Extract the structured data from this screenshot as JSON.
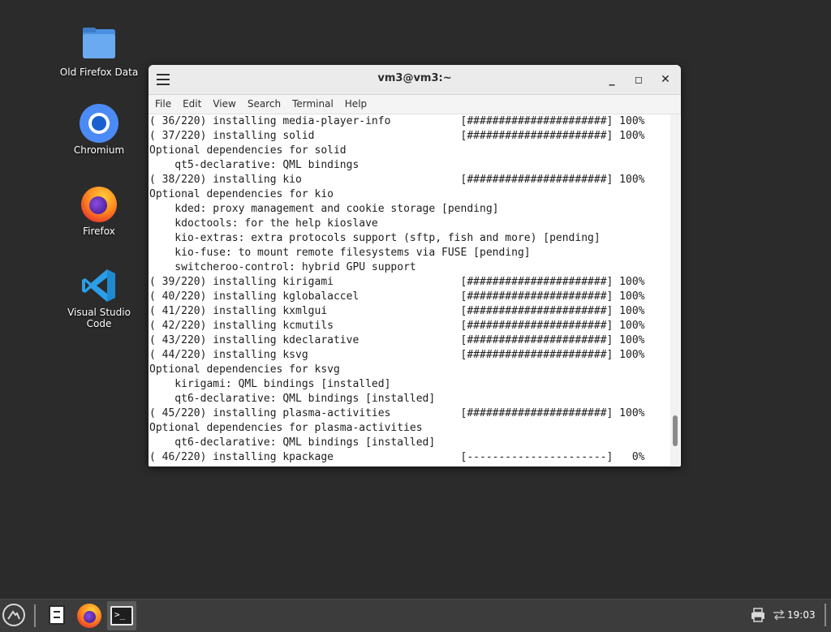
{
  "desktop": {
    "icons": [
      {
        "label": "Old Firefox Data",
        "icon": "folder-icon"
      },
      {
        "label": "Chromium",
        "icon": "chromium-icon"
      },
      {
        "label": "Firefox",
        "icon": "firefox-icon"
      },
      {
        "label": "Visual Studio\nCode",
        "icon": "vscode-icon"
      }
    ]
  },
  "window": {
    "title": "vm3@vm3:~",
    "menu": [
      "File",
      "Edit",
      "View",
      "Search",
      "Terminal",
      "Help"
    ],
    "buttons": {
      "minimize": "_",
      "maximize": "◻",
      "close": "✕"
    },
    "terminal_lines": [
      "( 36/220) installing media-player-info           [######################] 100%",
      "( 37/220) installing solid                       [######################] 100%",
      "Optional dependencies for solid",
      "    qt5-declarative: QML bindings",
      "( 38/220) installing kio                         [######################] 100%",
      "Optional dependencies for kio",
      "    kded: proxy management and cookie storage [pending]",
      "    kdoctools: for the help kioslave",
      "    kio-extras: extra protocols support (sftp, fish and more) [pending]",
      "    kio-fuse: to mount remote filesystems via FUSE [pending]",
      "    switcheroo-control: hybrid GPU support",
      "( 39/220) installing kirigami                    [######################] 100%",
      "( 40/220) installing kglobalaccel                [######################] 100%",
      "( 41/220) installing kxmlgui                     [######################] 100%",
      "( 42/220) installing kcmutils                    [######################] 100%",
      "( 43/220) installing kdeclarative                [######################] 100%",
      "( 44/220) installing ksvg                        [######################] 100%",
      "Optional dependencies for ksvg",
      "    kirigami: QML bindings [installed]",
      "    qt6-declarative: QML bindings [installed]",
      "( 45/220) installing plasma-activities           [######################] 100%",
      "Optional dependencies for plasma-activities",
      "    qt6-declarative: QML bindings [installed]",
      "( 46/220) installing kpackage                    [----------------------]   0%"
    ],
    "scroll_position": 0.95
  },
  "taskbar": {
    "clock": "19:03",
    "apps": [
      "file-manager-icon",
      "firefox-icon",
      "terminal-icon"
    ],
    "terminal_glyph": ">_"
  }
}
